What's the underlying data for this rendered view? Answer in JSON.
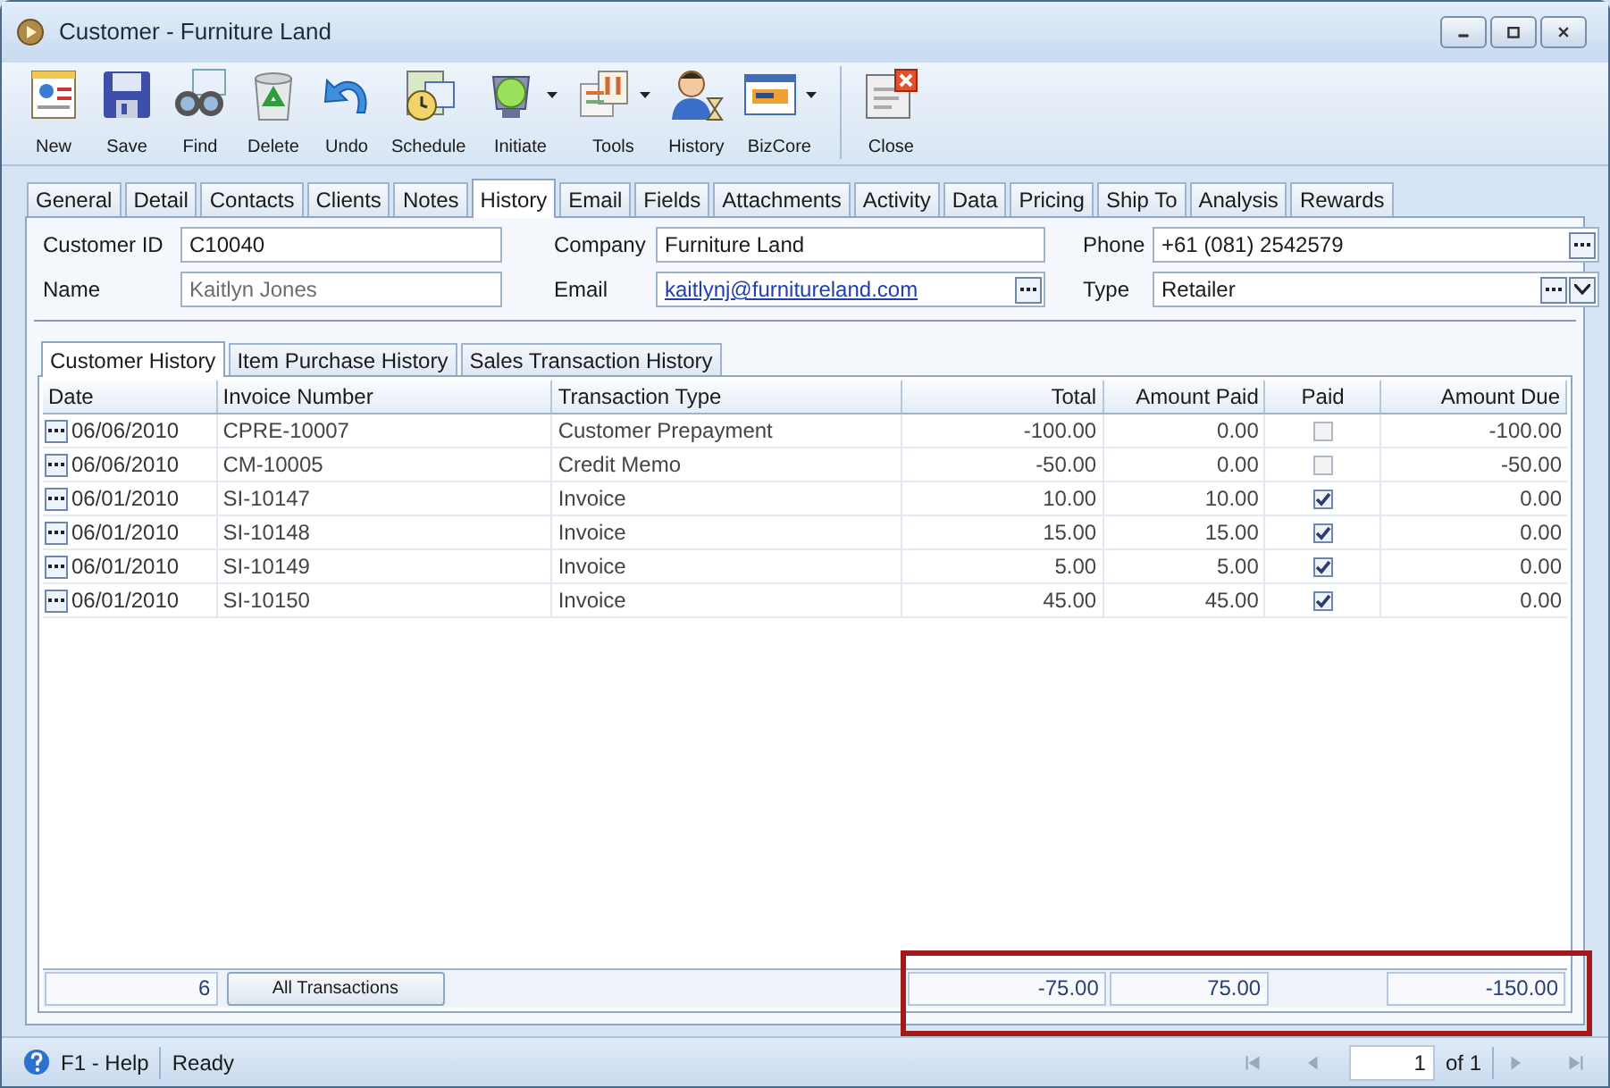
{
  "window": {
    "title": "Customer - Furniture Land"
  },
  "toolbar": [
    {
      "label": "New",
      "dropdown": false,
      "separator_before": false
    },
    {
      "label": "Save",
      "dropdown": false,
      "separator_before": false
    },
    {
      "label": "Find",
      "dropdown": false,
      "separator_before": false
    },
    {
      "label": "Delete",
      "dropdown": false,
      "separator_before": false
    },
    {
      "label": "Undo",
      "dropdown": false,
      "separator_before": false
    },
    {
      "label": "Schedule",
      "dropdown": false,
      "separator_before": false
    },
    {
      "label": "Initiate",
      "dropdown": true,
      "separator_before": false
    },
    {
      "label": "Tools",
      "dropdown": true,
      "separator_before": false
    },
    {
      "label": "History",
      "dropdown": false,
      "separator_before": false
    },
    {
      "label": "BizCore",
      "dropdown": true,
      "separator_before": false
    },
    {
      "label": "Close",
      "dropdown": false,
      "separator_before": true
    }
  ],
  "tabs": [
    {
      "label": "General",
      "selected": false
    },
    {
      "label": "Detail",
      "selected": false
    },
    {
      "label": "Contacts",
      "selected": false
    },
    {
      "label": "Clients",
      "selected": false
    },
    {
      "label": "Notes",
      "selected": false
    },
    {
      "label": "History",
      "selected": true
    },
    {
      "label": "Email",
      "selected": false
    },
    {
      "label": "Fields",
      "selected": false
    },
    {
      "label": "Attachments",
      "selected": false
    },
    {
      "label": "Activity",
      "selected": false
    },
    {
      "label": "Data",
      "selected": false
    },
    {
      "label": "Pricing",
      "selected": false
    },
    {
      "label": "Ship To",
      "selected": false
    },
    {
      "label": "Analysis",
      "selected": false
    },
    {
      "label": "Rewards",
      "selected": false
    }
  ],
  "form": {
    "customer_id": {
      "label": "Customer ID",
      "value": "C10040"
    },
    "name": {
      "label": "Name",
      "value": "Kaitlyn Jones"
    },
    "company": {
      "label": "Company",
      "value": "Furniture Land"
    },
    "email": {
      "label": "Email",
      "value": "kaitlynj@furnitureland.com"
    },
    "phone": {
      "label": "Phone",
      "value": "+61 (081) 2542579"
    },
    "type": {
      "label": "Type",
      "value": "Retailer"
    }
  },
  "subtabs": [
    {
      "label": "Customer History",
      "selected": true
    },
    {
      "label": "Item Purchase History",
      "selected": false
    },
    {
      "label": "Sales Transaction History",
      "selected": false
    }
  ],
  "table": {
    "columns": [
      "Date",
      "Invoice Number",
      "Transaction Type",
      "Total",
      "Amount Paid",
      "Paid",
      "Amount Due"
    ],
    "rows": [
      {
        "date": "06/06/2010",
        "invoice": "CPRE-10007",
        "type": "Customer Prepayment",
        "total": "-100.00",
        "amount_paid": "0.00",
        "paid": false,
        "amount_due": "-100.00"
      },
      {
        "date": "06/06/2010",
        "invoice": "CM-10005",
        "type": "Credit Memo",
        "total": "-50.00",
        "amount_paid": "0.00",
        "paid": false,
        "amount_due": "-50.00"
      },
      {
        "date": "06/01/2010",
        "invoice": "SI-10147",
        "type": "Invoice",
        "total": "10.00",
        "amount_paid": "10.00",
        "paid": true,
        "amount_due": "0.00"
      },
      {
        "date": "06/01/2010",
        "invoice": "SI-10148",
        "type": "Invoice",
        "total": "15.00",
        "amount_paid": "15.00",
        "paid": true,
        "amount_due": "0.00"
      },
      {
        "date": "06/01/2010",
        "invoice": "SI-10149",
        "type": "Invoice",
        "total": "5.00",
        "amount_paid": "5.00",
        "paid": true,
        "amount_due": "0.00"
      },
      {
        "date": "06/01/2010",
        "invoice": "SI-10150",
        "type": "Invoice",
        "total": "45.00",
        "amount_paid": "45.00",
        "paid": true,
        "amount_due": "0.00"
      }
    ],
    "footer": {
      "count": "6",
      "filter_button": "All Transactions",
      "total": "-75.00",
      "amount_paid": "75.00",
      "amount_due": "-150.00",
      "highlighted": true
    }
  },
  "status_bar": {
    "help": "F1 - Help",
    "status": "Ready",
    "page": "1",
    "of": "of 1"
  }
}
